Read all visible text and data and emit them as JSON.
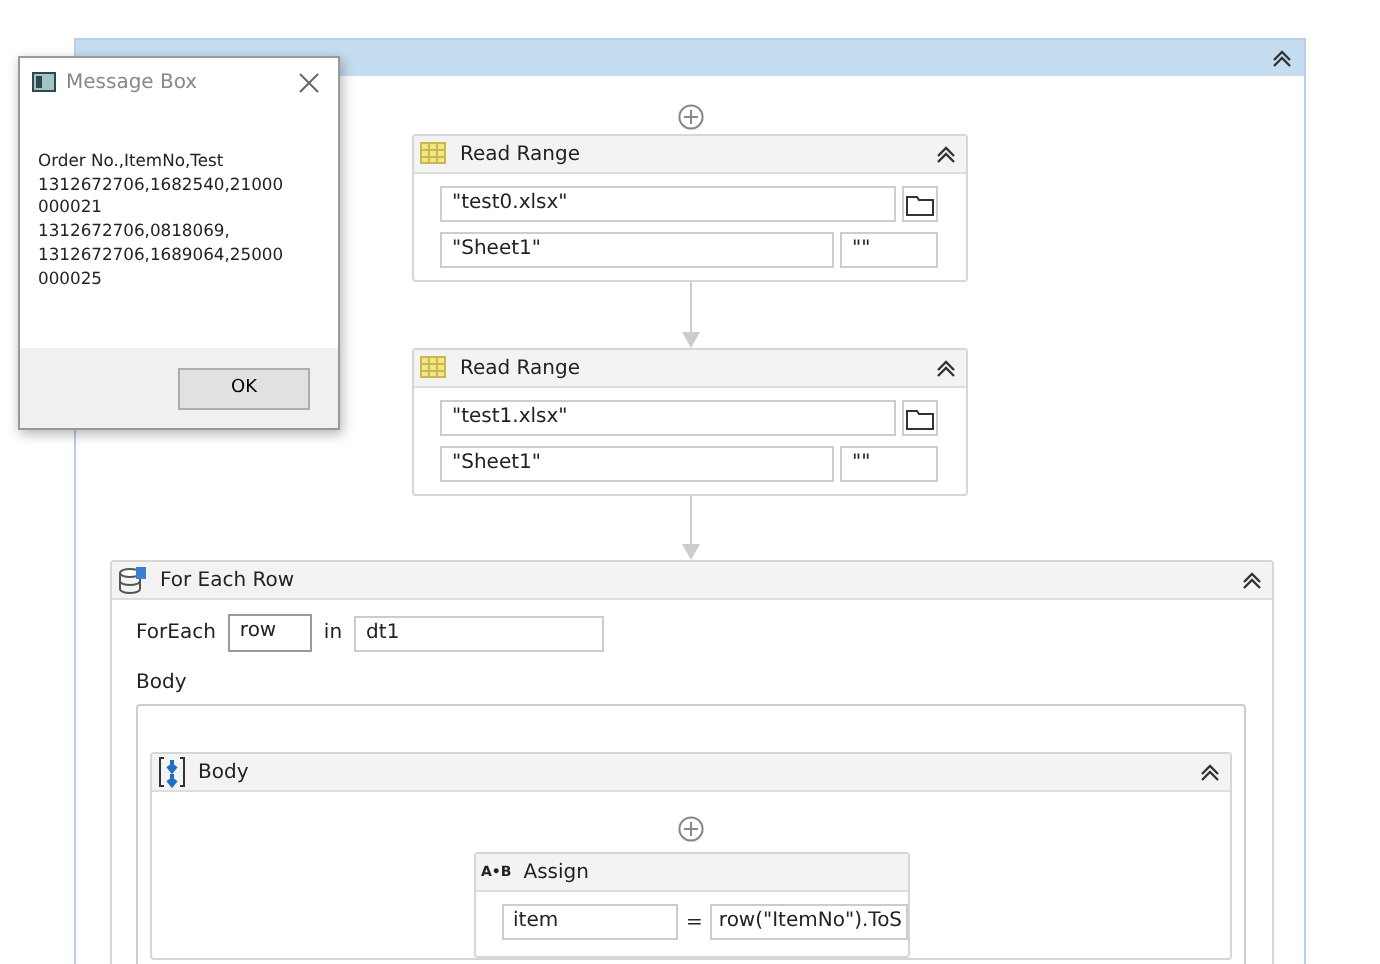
{
  "message_box": {
    "title": "Message Box",
    "lines": [
      "Order No.,ItemNo,Test",
      "1312672706,1682540,21000",
      "000021",
      "1312672706,0818069,",
      "1312672706,1689064,25000",
      "000025"
    ],
    "ok": "OK"
  },
  "read_ranges": [
    {
      "title": "Read Range",
      "file": "\"test0.xlsx\"",
      "sheet": "\"Sheet1\"",
      "range": "\"\""
    },
    {
      "title": "Read Range",
      "file": "\"test1.xlsx\"",
      "sheet": "\"Sheet1\"",
      "range": "\"\""
    }
  ],
  "for_each": {
    "title": "For Each Row",
    "foreach_label": "ForEach",
    "item": "row",
    "in_label": "in",
    "collection": "dt1",
    "body_label": "Body",
    "body_title": "Body"
  },
  "assign": {
    "icon": "A•B",
    "title": "Assign",
    "to": "item",
    "equals": "=",
    "value": "row(\"ItemNo\").ToS"
  }
}
